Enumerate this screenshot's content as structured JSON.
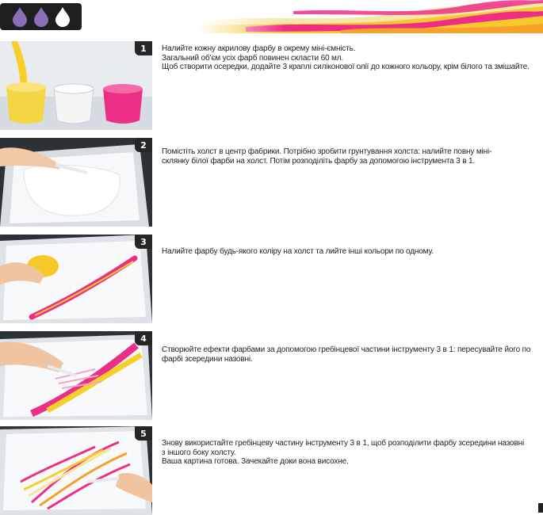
{
  "header": {
    "drops": [
      {
        "name": "drop-icon",
        "color": "#8a6fb8"
      },
      {
        "name": "drop-icon",
        "color": "#8a6fb8"
      },
      {
        "name": "drop-icon",
        "color": "#ffffff"
      }
    ],
    "banner_colors": [
      "#f7c72d",
      "#ee2e86",
      "#f5e7a8"
    ]
  },
  "steps": [
    {
      "number": "1",
      "lines": [
        "Налийте кожну акрилову фарбу в окрему міні-ємність.",
        "Загальний об'єм усіх фарб повинен скласти 60 мл.",
        "Щоб створити осередки, додайте 3 краплі силіконової олії до кожного кольору, крім білого та змішайте."
      ]
    },
    {
      "number": "2",
      "lines": [
        "Помістіть холст в центр фабрики. Потрібно зробити грунтування холста: налийте повну міні-склянку білої фарби на холст. Потім розподіліть фарбу за допомогою інструмента 3 в 1."
      ]
    },
    {
      "number": "3",
      "lines": [
        "Налийте фарбу будь-якого коліру на холст та лийте інші кольори по одному."
      ]
    },
    {
      "number": "4",
      "lines": [
        "Створюйте ефекти фарбами за допомогою гребінцевої частини інструменту 3 в 1: пересувайте його по фарбі зсередини назовні."
      ]
    },
    {
      "number": "5",
      "lines": [
        "Знову використайте гребінцеву частину інструменту 3 в 1, щоб розподілити фарбу зсередини назовні з іншого боку холсту.",
        "Ваша картина готова. Зачекайте доки вона висохне."
      ]
    }
  ]
}
